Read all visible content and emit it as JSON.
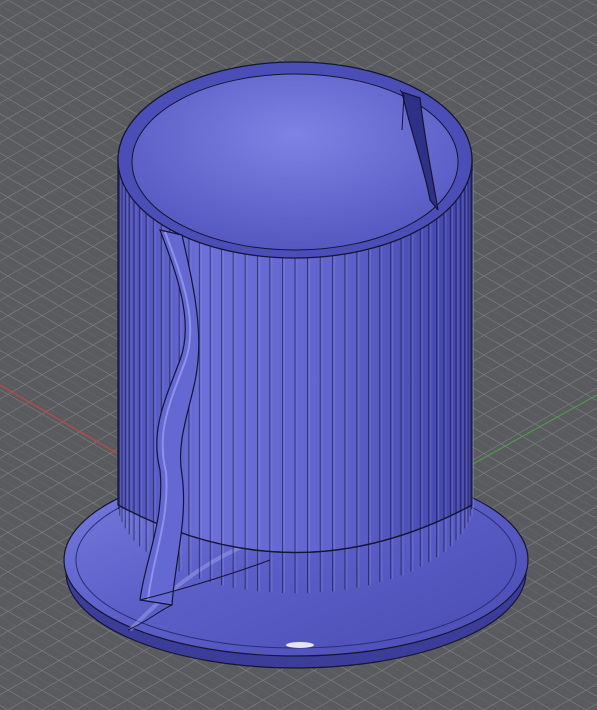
{
  "viewport": {
    "background": "#5a5b5e",
    "grid_color": "#7b7c80",
    "grid_minor_color": "#6b6c70",
    "x_axis_color": "#c24848",
    "y_axis_color": "#4c9a4c"
  },
  "model": {
    "body_color": "#5d60c9",
    "body_dark": "#3a3c98",
    "body_light": "#8e92ec",
    "edge_color": "#141633",
    "fluted_ribs": 44
  }
}
